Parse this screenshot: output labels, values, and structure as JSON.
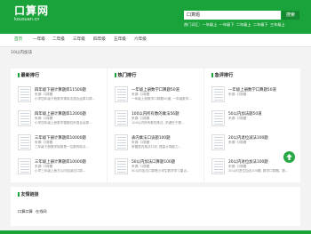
{
  "brand": {
    "name_cn": "口算网",
    "name_en": "kousuan.cn",
    "accent": "#1aa33a"
  },
  "search": {
    "value": "口算题",
    "button": "搜索"
  },
  "hotwords": {
    "label": "热门词汇:",
    "items": [
      "一年级上",
      "一年级下",
      "二年级上",
      "二年级下",
      "三年级上"
    ]
  },
  "nav": [
    "首页",
    "一年级",
    "二年级",
    "三年级",
    "四年级",
    "五年级",
    "六年级"
  ],
  "breadcrumb": "10以内加法",
  "panels": [
    {
      "title": "最新排行",
      "items": [
        {
          "title": "四年级下册计算题库11500题",
          "sub": "来源: 口算题",
          "desc": "小学四年级下册数学乘除法混合运算口算..."
        },
        {
          "title": "四年级上册计算题库12000题",
          "sub": "来源: 口算题",
          "desc": "小学四年级上册数学整数四则混合运算..."
        },
        {
          "title": "三年级下册计算题库10000题",
          "sub": "来源: 口算题",
          "desc": "三年级下册数学除数是一位数的除法..."
        },
        {
          "title": "三年级上册计算题库10000题",
          "sub": "来源: 口算题",
          "desc": "小学三年级上册万以内加减法口算..."
        }
      ]
    },
    {
      "title": "热门排行",
      "items": [
        {
          "title": "一年级上册数学口算题50道",
          "sub": "来源: 口算题",
          "desc": "一年级上册数学口算题50道, 一年级数学..."
        },
        {
          "title": "100以内所有数的乘法56题",
          "sub": "来源: 口算题",
          "desc": "100以内所有数的乘法, 关键在于理..."
        },
        {
          "title": "表内乘法口诀题100题",
          "sub": "来源: 口算题",
          "desc": "掌握表内乘法口诀, 提高计算能力..."
        },
        {
          "title": "50以内加法口算题100题",
          "sub": "来源: 口算题",
          "desc": "50以内加法口算是小学生数学学习重点..."
        }
      ]
    },
    {
      "title": "急评排行",
      "items": [
        {
          "title": "一年级上册数学口算题50道",
          "sub": "来源: 口算题",
          "desc": ""
        },
        {
          "title": "50以内加法题50道",
          "sub": "来源: 口算题",
          "desc": ""
        },
        {
          "title": "20以内退位减法100题",
          "sub": "来源: 口算题",
          "desc": ""
        },
        {
          "title": "20以内进位加法100题",
          "sub": "来源: 口算题",
          "desc": "20以内进位加法100题, 数学口算题。数..."
        }
      ]
    }
  ],
  "links": {
    "title": "友情链接",
    "items": [
      "口算口算",
      "在线网"
    ]
  }
}
